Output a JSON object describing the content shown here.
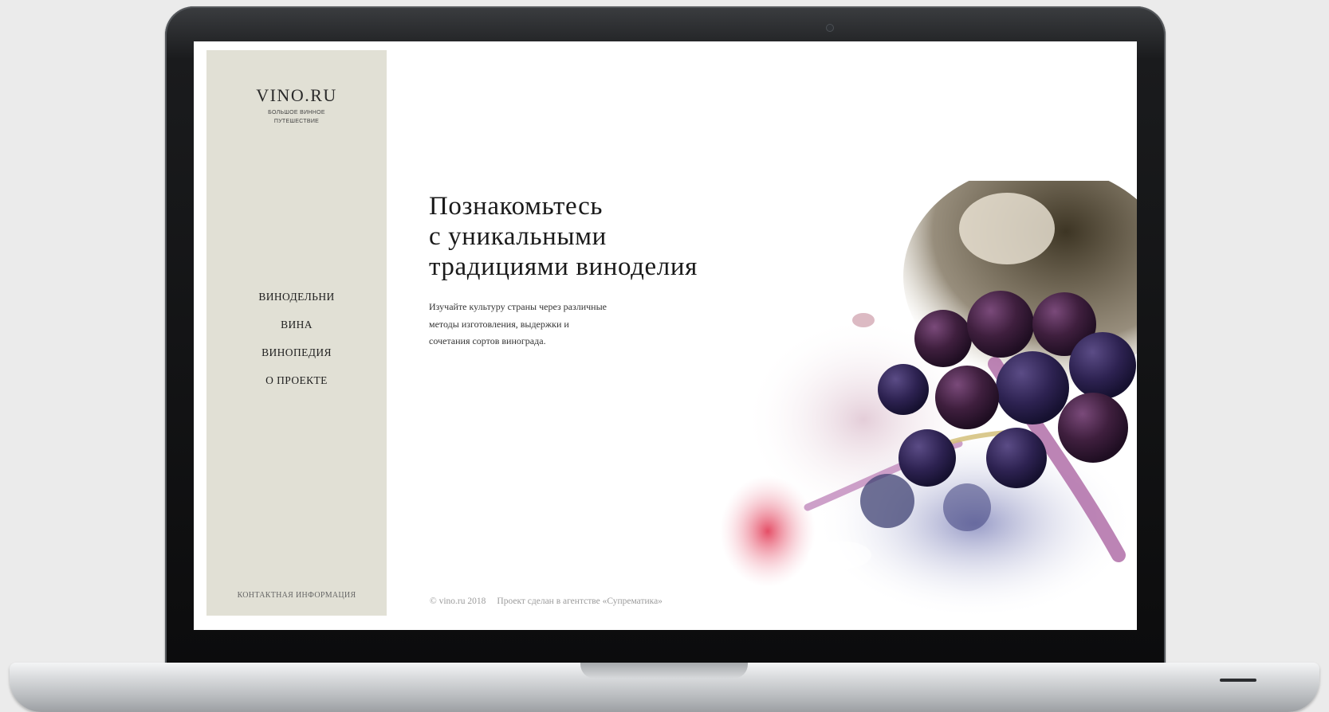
{
  "site": {
    "logo": "VINO.RU",
    "tagline_line1": "БОЛЬШОЕ ВИННОЕ",
    "tagline_line2": "ПУТЕШЕСТВИЕ"
  },
  "nav": {
    "items": [
      {
        "label": "ВИНОДЕЛЬНИ"
      },
      {
        "label": "ВИНА"
      },
      {
        "label": "ВИНОПЕДИЯ"
      },
      {
        "label": "О ПРОЕКТЕ"
      }
    ],
    "contact_label": "КОНТАКТНАЯ ИНФОРМАЦИЯ"
  },
  "hero": {
    "title_line1": "Познакомьтесь",
    "title_line2": "с уникальными",
    "title_line3": "традициями виноделия",
    "text_line1": "Изучайте культуру страны через различные",
    "text_line2": "методы изготовления, выдержки и",
    "text_line3": "сочетания сортов винограда."
  },
  "footer": {
    "copyright": "© vino.ru 2018",
    "agency": "Проект сделан в агентстве «Супрематика»"
  },
  "colors": {
    "sidebar_bg": "#e1e0d5",
    "screen_bg": "#ffffff",
    "text_dark": "#1a1a1a",
    "footer_text": "#9b9b9b"
  }
}
